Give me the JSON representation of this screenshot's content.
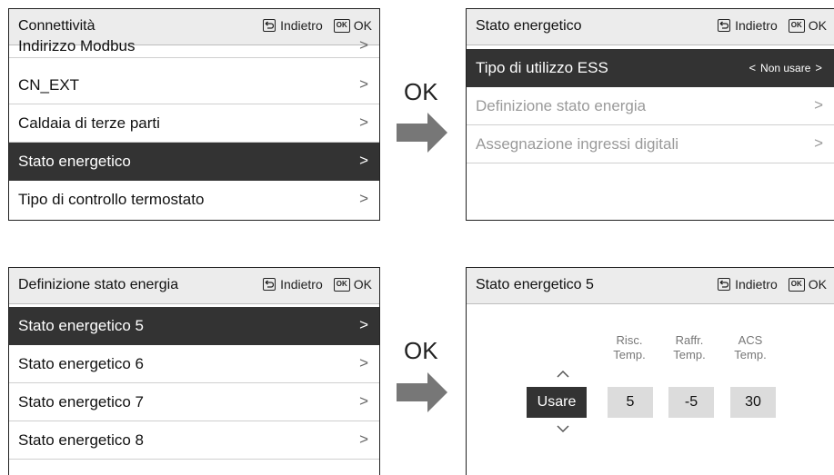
{
  "common": {
    "back_label": "Indietro",
    "ok_badge": "OK",
    "ok_label": "OK",
    "chevron": ">"
  },
  "panel1": {
    "title": "Connettività",
    "items": [
      {
        "label": "Indirizzo Modbus"
      },
      {
        "label": "CN_EXT"
      },
      {
        "label": "Caldaia di terze parti"
      },
      {
        "label": "Stato energetico"
      },
      {
        "label": "Tipo di controllo termostato"
      }
    ]
  },
  "panel2": {
    "title": "Stato energetico",
    "items": [
      {
        "label": "Tipo di utilizzo ESS",
        "value": "Non usare",
        "left_arrow": "<",
        "right_arrow": ">"
      },
      {
        "label": "Definizione stato energia"
      },
      {
        "label": "Assegnazione ingressi digitali"
      }
    ]
  },
  "panel3": {
    "title": "Definizione stato energia",
    "items": [
      {
        "label": "Stato energetico 5"
      },
      {
        "label": "Stato energetico 6"
      },
      {
        "label": "Stato energetico 7"
      },
      {
        "label": "Stato energetico 8"
      }
    ]
  },
  "panel4": {
    "title": "Stato energetico 5",
    "columns": [
      {
        "line1": "Risc.",
        "line2": "Temp.",
        "value": "5"
      },
      {
        "line1": "Raffr.",
        "line2": "Temp.",
        "value": "-5"
      },
      {
        "line1": "ACS",
        "line2": "Temp.",
        "value": "30"
      }
    ],
    "mode_value": "Usare"
  },
  "icons": [
    "back-icon",
    "ok-key-icon",
    "right-arrow-icon",
    "chevron-up-icon",
    "chevron-down-icon"
  ]
}
